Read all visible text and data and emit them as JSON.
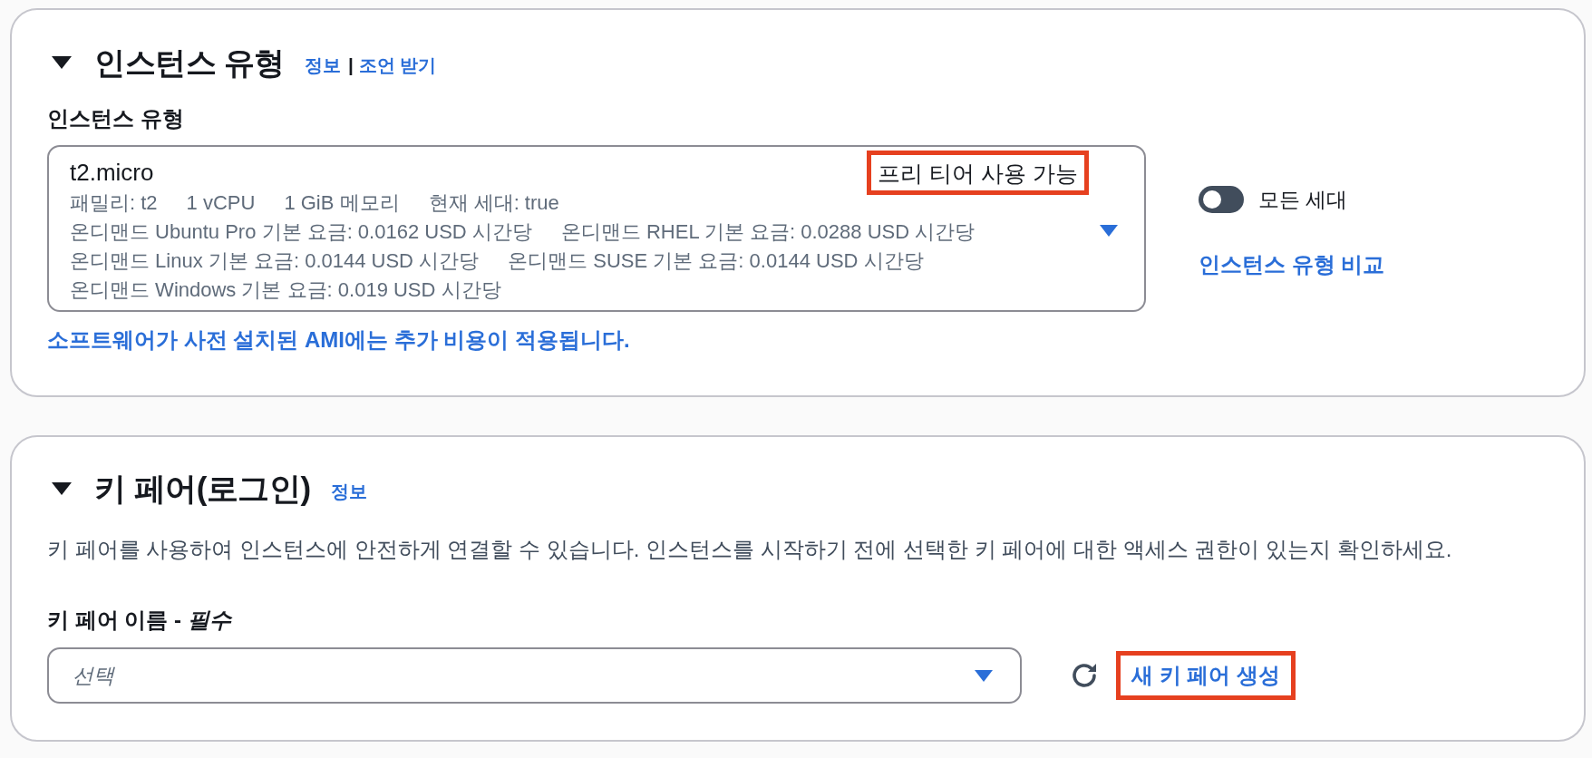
{
  "instance_type": {
    "expanded": true,
    "title": "인스턴스 유형",
    "links": [
      {
        "label": "정보"
      },
      {
        "label": "조언 받기"
      }
    ],
    "link_separator": "|",
    "field_label": "인스턴스 유형",
    "select": {
      "value": "t2.micro",
      "badge": {
        "label": "프리 티어 사용 가능",
        "highlighted": true
      },
      "detail_lines": [
        [
          "패밀리: t2",
          "1 vCPU",
          "1 GiB 메모리",
          "현재 세대: true"
        ],
        [
          "온디맨드 Ubuntu Pro 기본 요금: 0.0162 USD 시간당",
          "온디맨드 RHEL 기본 요금: 0.0288 USD 시간당"
        ],
        [
          "온디맨드 Linux 기본 요금: 0.0144 USD 시간당",
          "온디맨드 SUSE 기본 요금: 0.0144 USD 시간당"
        ],
        [
          "온디맨드 Windows 기본 요금: 0.019 USD 시간당"
        ]
      ]
    },
    "toggle": {
      "label": "모든 세대",
      "on": false
    },
    "compare_link": "인스턴스 유형 비교",
    "note_link": "소프트웨어가 사전 설치된 AMI에는 추가 비용이 적용됩니다."
  },
  "key_pair": {
    "expanded": true,
    "title": "키 페어(로그인)",
    "links": [
      {
        "label": "정보"
      }
    ],
    "description": "키 페어를 사용하여 인스턴스에 안전하게 연결할 수 있습니다. 인스턴스를 시작하기 전에 선택한 키 페어에 대한 액세스 권한이 있는지 확인하세요.",
    "field_label": "키 페어 이름 - *필수*",
    "select": {
      "placeholder": "선택"
    },
    "create_link": {
      "label": "새 키 페어 생성",
      "highlighted": true
    }
  }
}
